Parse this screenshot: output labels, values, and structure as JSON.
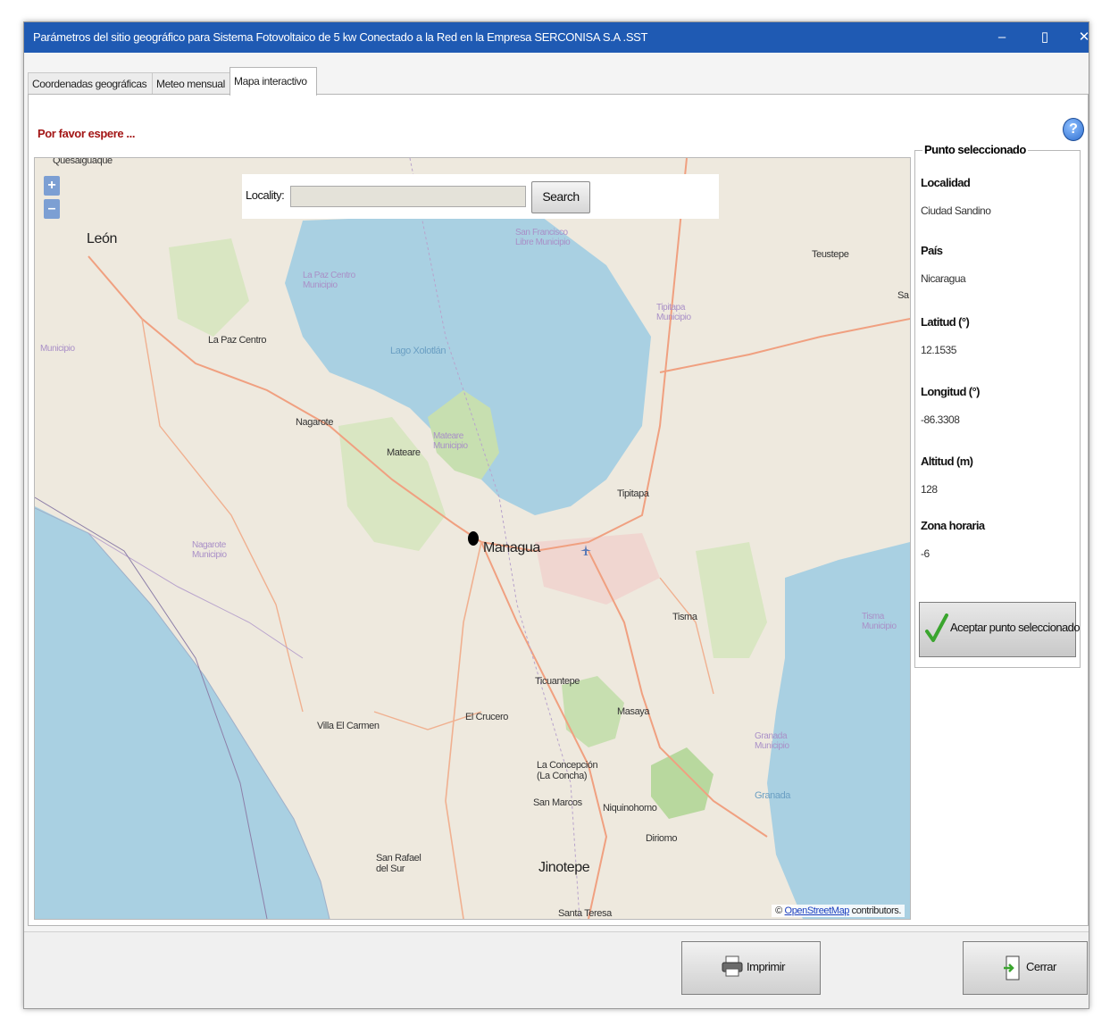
{
  "window": {
    "title": "Parámetros del sitio geográfico para Sistema Fotovoltaico de 5 kw Conectado a la Red en la Empresa SERCONISA S.A .SST",
    "minimize": "–",
    "maximize": "▯",
    "close": "✕"
  },
  "tabs": [
    {
      "label": "Coordenadas geográficas"
    },
    {
      "label": "Meteo mensual"
    },
    {
      "label": "Mapa interactivo",
      "active": true
    }
  ],
  "status": "Por favor espere ...",
  "help_icon": "question-icon",
  "map": {
    "zoom_in": "+",
    "zoom_out": "–",
    "search": {
      "label": "Locality:",
      "value": "",
      "button": "Search"
    },
    "labels": {
      "queschapa": "Quesalguaque",
      "leon": "León",
      "la_paz_centro": "La Paz Centro",
      "nagarote": "Nagarote",
      "mateare": "Mateare",
      "managua": "Managua",
      "tipitapa": "Tipitapa",
      "tisma": "Tisma",
      "ticuantepe": "Ticuantepe",
      "el_crucero": "El Crucero",
      "masaya": "Masaya",
      "villa_el_carmen": "Villa El Carmen",
      "la_concepcion": "La Concepción (La Concha)",
      "san_marcos": "San Marcos",
      "niquinohomo": "Niquinohomo",
      "diriomo": "Diriomo",
      "san_rafael": "San Rafael del Sur",
      "jinotepe": "Jinotepe",
      "santa_teresa": "Santa Teresa",
      "granada": "Granada",
      "teustepe": "Teustepe",
      "lago": "Lago Xolotlán",
      "la_paz_mun": "La Paz Centro Municipio",
      "san_francisco": "San Francisco Libre Municipio",
      "tipitapa_mun": "Tipitapa Municipio",
      "mateare_mun": "Mateare Municipio",
      "nagarote_mun": "Nagarote Municipio",
      "granada_mun": "Granada Municipio",
      "leon_mun": "Municipio",
      "tisma_mun": "Tisma Municipio",
      "sa": "Sa"
    },
    "attribution_prefix": "©",
    "attribution_link": "OpenStreetMap",
    "attribution_suffix": "contributors."
  },
  "selected_point": {
    "legend": "Punto seleccionado",
    "fields": [
      {
        "label": "Localidad",
        "value": "Ciudad Sandino"
      },
      {
        "label": "País",
        "value": "Nicaragua"
      },
      {
        "label": "Latitud (°)",
        "value": "12.1535"
      },
      {
        "label": "Longitud (°)",
        "value": "-86.3308"
      },
      {
        "label": "Altitud (m)",
        "value": "128"
      },
      {
        "label": "Zona horaria",
        "value": "-6"
      }
    ],
    "accept_button": "Aceptar punto seleccionado"
  },
  "footer": {
    "print_button": "Imprimir",
    "close_button": "Cerrar"
  },
  "colors": {
    "titlebar": "#1f5ab3",
    "water": "#a9d0e2",
    "land": "#eee9de",
    "status_text": "#a31616"
  }
}
